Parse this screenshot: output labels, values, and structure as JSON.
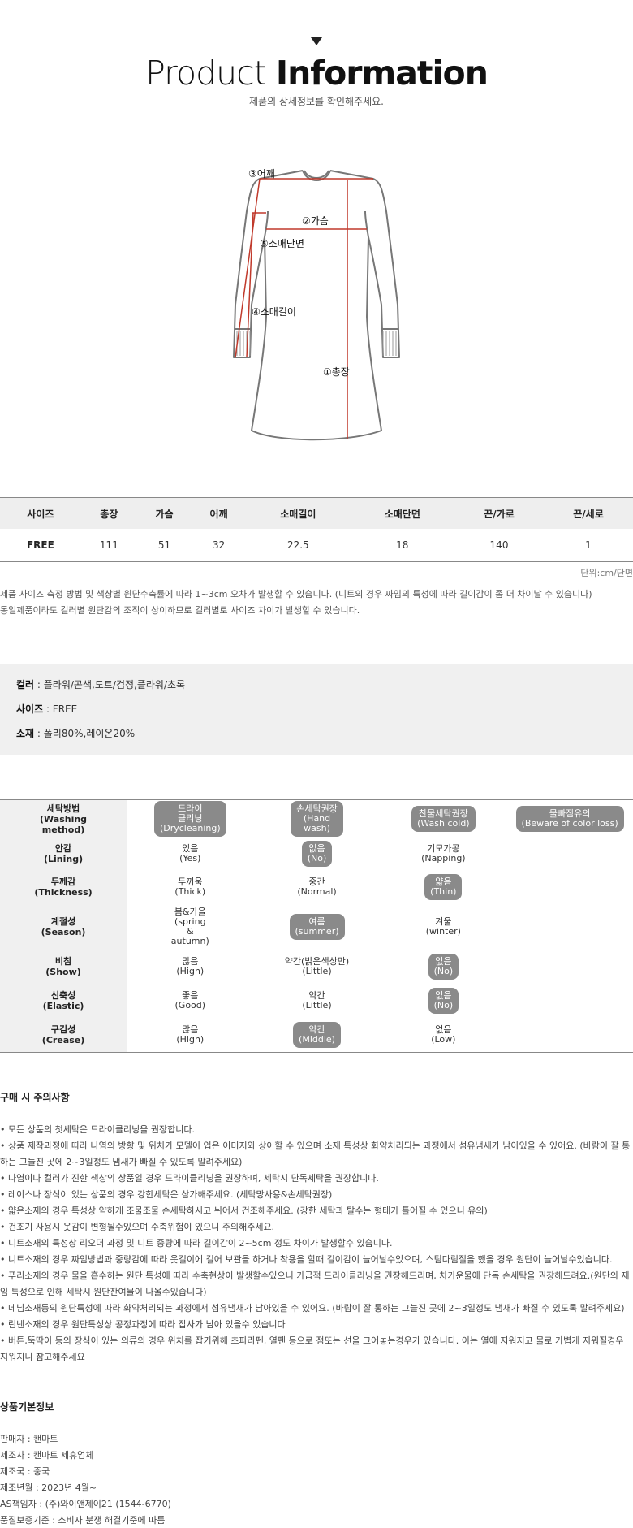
{
  "header": {
    "title_light": "Product",
    "title_bold": "Information",
    "subtitle": "제품의 상세정보를 확인해주세요."
  },
  "illustration": {
    "labels": [
      "③어깨",
      "②가슴",
      "⑤소매단면",
      "④소매길이",
      "①총장"
    ],
    "guide_color": "#c0392b"
  },
  "size_table": {
    "headers": [
      "사이즈",
      "총장",
      "가슴",
      "어깨",
      "소매길이",
      "소매단면",
      "끈/가로",
      "끈/세로"
    ],
    "rows": [
      [
        "FREE",
        "111",
        "51",
        "32",
        "22.5",
        "18",
        "140",
        "1"
      ]
    ],
    "unit": "단위:cm/단면"
  },
  "size_notes": [
    "제품 사이즈 측정 방법 및 색상별 원단수축률에 따라 1~3cm 오차가 발생할 수 있습니다. (니트의 경우 짜임의 특성에 따라 길이감이 좀 더 차이날 수 있습니다)",
    "동일제품이라도 컬러별 원단감의 조직이 상이하므로 컬러별로 사이즈 차이가 발생할 수 있습니다."
  ],
  "product_info": {
    "color_label": "컬러",
    "color_value": " : 플라워/곤색,도트/검정,플라워/초록",
    "size_label": "사이즈",
    "size_value": " : FREE",
    "material_label": "소재",
    "material_value": " : 폴리80%,레이온20%"
  },
  "care_table": {
    "rows": [
      {
        "label": [
          "세탁방법",
          "(Washing",
          "method)"
        ],
        "cells": [
          {
            "lines": [
              "드라이",
              "클리닝",
              "(Drycleaning)"
            ],
            "selected": true
          },
          {
            "lines": [
              "손세탁권장",
              "(Hand",
              "wash)"
            ],
            "selected": true
          },
          {
            "lines": [
              "찬물세탁권장",
              "(Wash cold)"
            ],
            "selected": true
          },
          {
            "lines": [
              "물빠짐유의",
              "(Beware of color loss)"
            ],
            "selected": true
          }
        ]
      },
      {
        "label": [
          "안감",
          "(Lining)"
        ],
        "cells": [
          {
            "lines": [
              "있음",
              "(Yes)"
            ],
            "selected": false
          },
          {
            "lines": [
              "없음",
              "(No)"
            ],
            "selected": true
          },
          {
            "lines": [
              "기모가공",
              "(Napping)"
            ],
            "selected": false
          },
          {
            "lines": [],
            "selected": false
          }
        ]
      },
      {
        "label": [
          "두께감",
          "(Thickness)"
        ],
        "cells": [
          {
            "lines": [
              "두꺼움",
              "(Thick)"
            ],
            "selected": false
          },
          {
            "lines": [
              "중간",
              "(Normal)"
            ],
            "selected": false
          },
          {
            "lines": [
              "얇음",
              "(Thin)"
            ],
            "selected": true
          },
          {
            "lines": [],
            "selected": false
          }
        ]
      },
      {
        "label": [
          "계절성",
          "(Season)"
        ],
        "cells": [
          {
            "lines": [
              "봄&가을",
              "(spring",
              "&",
              "autumn)"
            ],
            "selected": false
          },
          {
            "lines": [
              "여름",
              "(summer)"
            ],
            "selected": true
          },
          {
            "lines": [
              "겨울",
              "(winter)"
            ],
            "selected": false
          },
          {
            "lines": [],
            "selected": false
          }
        ]
      },
      {
        "label": [
          "비침",
          "(Show)"
        ],
        "cells": [
          {
            "lines": [
              "많음",
              "(High)"
            ],
            "selected": false
          },
          {
            "lines": [
              "약간(밝은색상만)",
              "(Little)"
            ],
            "selected": false
          },
          {
            "lines": [
              "없음",
              "(No)"
            ],
            "selected": true
          },
          {
            "lines": [],
            "selected": false
          }
        ]
      },
      {
        "label": [
          "신축성",
          "(Elastic)"
        ],
        "cells": [
          {
            "lines": [
              "좋음",
              "(Good)"
            ],
            "selected": false
          },
          {
            "lines": [
              "약간",
              "(Little)"
            ],
            "selected": false
          },
          {
            "lines": [
              "없음",
              "(No)"
            ],
            "selected": true
          },
          {
            "lines": [],
            "selected": false
          }
        ]
      },
      {
        "label": [
          "구김성",
          "(Crease)"
        ],
        "cells": [
          {
            "lines": [
              "많음",
              "(High)"
            ],
            "selected": false
          },
          {
            "lines": [
              "약간",
              "(Middle)"
            ],
            "selected": true
          },
          {
            "lines": [
              "없음",
              "(Low)"
            ],
            "selected": false
          },
          {
            "lines": [],
            "selected": false
          }
        ]
      }
    ],
    "pill_color": "#8a8a8a"
  },
  "cautions": {
    "title": "구매 시 주의사항",
    "items": [
      "• 모든 상품의 첫세탁은 드라이클리닝을 권장합니다.",
      "• 상품 제작과정에 따라 나염의 방향 및 위치가 모델이 입은 이미지와 상이할 수 있으며 소재 특성상 화약처리되는 과정에서 섬유냄새가 남아있을 수 있어요. (바람이 잘 통",
      "하는 그늘진 곳에 2~3일정도 냄새가 빠질 수 있도록 말려주세요)",
      "• 나염이나 컬러가 진한 색상의 상품일 경우 드라이클리닝을 권장하며, 세탁시 단독세탁을 권장합니다.",
      "• 레이스나 장식이 있는 상품의 경우 강한세탁은 삼가해주세요. (세탁망사용&손세탁권장)",
      "• 얇은소재의 경우 특성상 약하게 조물조물 손세탁하시고 뉘어서 건조해주세요. (강한 세탁과 탈수는 형태가 틀어질 수 있으니 유의)",
      "• 건조기 사용시 옷감이 변형될수있으며 수축위험이 있으니 주의해주세요.",
      "• 니트소재의 특성상 리오더 과정 및 니트 중량에 따라 길이감이 2~5cm 정도 차이가 발생할수 있습니다.",
      "• 니트소재의 경우 짜임방법과 중량감에 따라 옷걸이에 걸어 보관을 하거나 착용을 할때 길이감이 늘어날수있으며, 스팀다림질을 했을 경우 원단이 늘어날수있습니다.",
      "• 푸리소재의 경우 물을 흡수하는 원단 특성에 따라 수축현상이 발생할수있으니 가급적 드라이클리닝을 권장해드리며, 차가운물에 단독 손세탁을 권장해드려요.(원단의 재",
      "임 특성으로 인해 세탁시 원단잔여물이 나올수있습니다)",
      "• 데님소재등의 원단특성에 따라 화약처리되는 과정에서 섬유냄새가 남아있을 수 있어요. (바람이 잘 통하는 그늘진 곳에 2~3일정도 냄새가 빠질 수 있도록 말려주세요)",
      "• 린넨소재의 경우 원단특성상 공정과정에 따라 잡사가 남아 있을수 있습니다",
      "• 버튼,뚝딱이 등의 장식이 있는 의류의 경우 위치를 잡기위해 초파라펜, 열펜 등으로 점또는 선을 그어놓는경우가 있습니다. 이는 열에 지워지고 물로 가볍게 지워질경우",
      "지워지니 참고해주세요"
    ]
  },
  "basic_info": {
    "title": "상품기본정보",
    "items": [
      "판매자 : 캔마트",
      "제조사 : 캔마트 제휴업체",
      "제조국 : 중국",
      "제조년월 : 2023년 4월~",
      "AS책임자 : (주)와이앤제이21 (1544-6770)",
      "품질보증기준 : 소비자 분쟁 해결기준에 따름"
    ]
  }
}
